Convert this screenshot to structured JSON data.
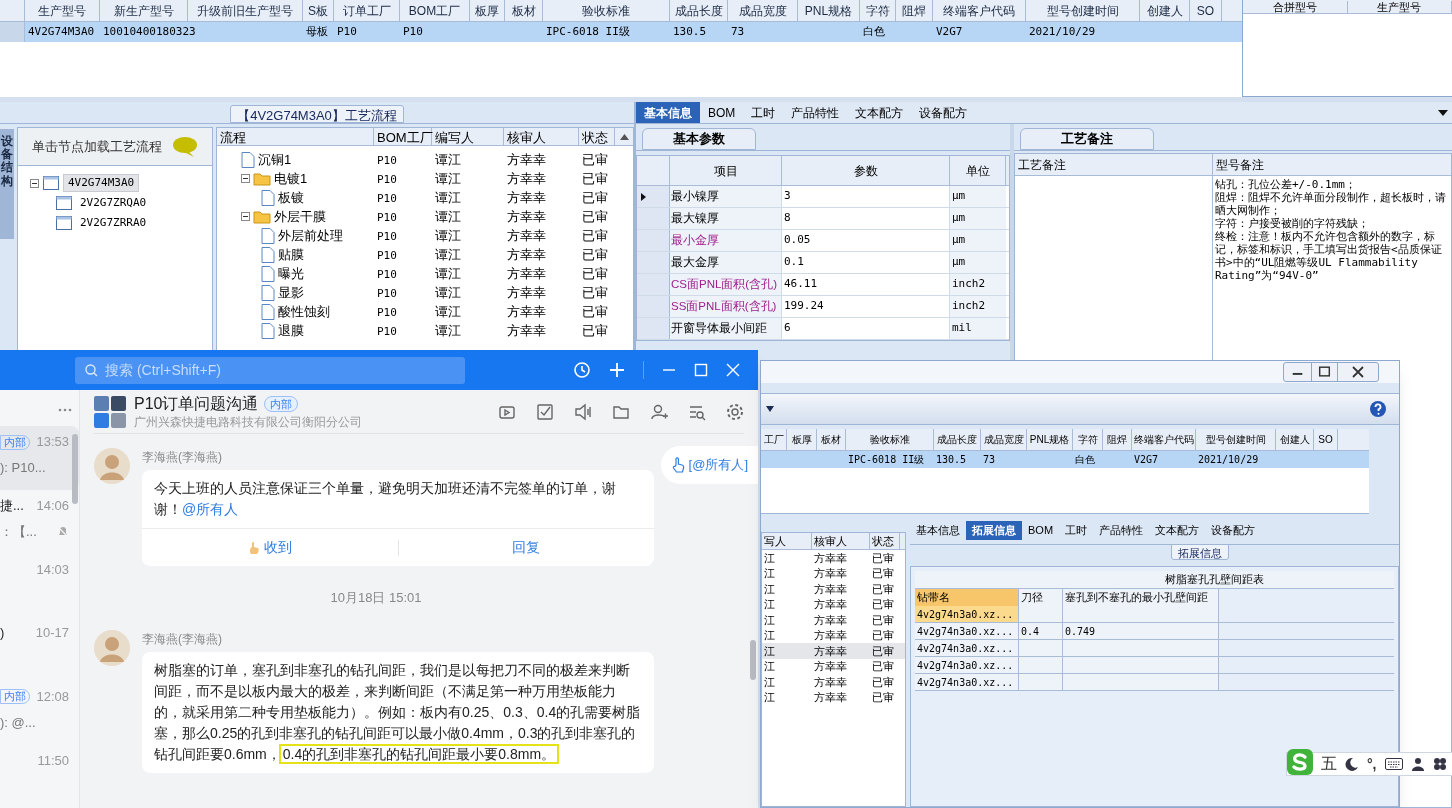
{
  "main_window": {
    "model_table": {
      "row_selected": true,
      "columns": [
        {
          "label": "生产型号",
          "value": "4V2G74M3A0"
        },
        {
          "label": "新生产型号",
          "value": "10010400180323"
        },
        {
          "label": "升级前旧生产型号"
        },
        {
          "label": "S板",
          "value": "母板"
        },
        {
          "label": "订单工厂",
          "value": "P10"
        },
        {
          "label": "BOM工厂",
          "value": "P10"
        },
        {
          "label": "板厚"
        },
        {
          "label": "板材"
        },
        {
          "label": "验收标准",
          "value": "IPC-6018 II级"
        },
        {
          "label": "成品长度",
          "value": "130.5"
        },
        {
          "label": "成品宽度",
          "value": "73"
        },
        {
          "label": "PNL规格"
        },
        {
          "label": "字符",
          "value": "白色"
        },
        {
          "label": "阻焊"
        },
        {
          "label": "终端客户代码",
          "value": "V2G7"
        },
        {
          "label": "型号创建时间",
          "value": "2021/10/29"
        },
        {
          "label": "创建人"
        },
        {
          "label": "SO"
        }
      ]
    },
    "merge_panel": {
      "columns": [
        "合拼型号",
        "生产型号"
      ]
    },
    "process_panel": {
      "title": "【4V2G74M3A0】工艺流程",
      "side_tab": "设备结构",
      "hint": "单击节点加载工艺流程",
      "model_tree": [
        {
          "label": "4V2G74M3A0",
          "selected": true,
          "expanded": true,
          "children": [
            {
              "label": "2V2G7ZRQA0",
              "selected": false
            },
            {
              "label": "2V2G7ZRRA0",
              "selected": false
            }
          ]
        }
      ],
      "flow_columns": [
        "流程",
        "BOM工厂",
        "编写人",
        "核审人",
        "状态"
      ],
      "flow_rows": [
        {
          "kind": "step",
          "name": "沉铜1",
          "bom": "P10",
          "writer": "谭江",
          "reviewer": "方幸幸",
          "status": "已审"
        },
        {
          "kind": "folder",
          "expanded": true,
          "name": "电镀1",
          "bom": "P10",
          "writer": "谭江",
          "reviewer": "方幸幸",
          "status": "已审",
          "children": [
            {
              "kind": "step",
              "name": "板镀",
              "bom": "P10",
              "writer": "谭江",
              "reviewer": "方幸幸",
              "status": "已审"
            }
          ]
        },
        {
          "kind": "folder",
          "expanded": true,
          "name": "外层干膜",
          "bom": "P10",
          "writer": "谭江",
          "reviewer": "方幸幸",
          "status": "已审",
          "children": [
            {
              "kind": "step",
              "name": "外层前处理",
              "bom": "P10",
              "writer": "谭江",
              "reviewer": "方幸幸",
              "status": "已审"
            },
            {
              "kind": "step",
              "name": "贴膜",
              "bom": "P10",
              "writer": "谭江",
              "reviewer": "方幸幸",
              "status": "已审"
            },
            {
              "kind": "step",
              "name": "曝光",
              "bom": "P10",
              "writer": "谭江",
              "reviewer": "方幸幸",
              "status": "已审"
            },
            {
              "kind": "step",
              "name": "显影",
              "bom": "P10",
              "writer": "谭江",
              "reviewer": "方幸幸",
              "status": "已审"
            },
            {
              "kind": "step",
              "name": "酸性蚀刻",
              "bom": "P10",
              "writer": "谭江",
              "reviewer": "方幸幸",
              "status": "已审"
            },
            {
              "kind": "step",
              "name": "退膜",
              "bom": "P10",
              "writer": "谭江",
              "reviewer": "方幸幸",
              "status": "已审"
            }
          ]
        }
      ]
    },
    "info_tabs": [
      {
        "label": "基本信息",
        "selected": true
      },
      {
        "label": "BOM",
        "selected": false
      },
      {
        "label": "工时",
        "selected": false
      },
      {
        "label": "产品特性",
        "selected": false
      },
      {
        "label": "文本配方",
        "selected": false
      },
      {
        "label": "设备配方",
        "selected": false
      }
    ],
    "param_tab": "基本参数",
    "param_columns": [
      "项目",
      "参数",
      "单位"
    ],
    "params": [
      {
        "item": "最小镍厚",
        "value": "3",
        "unit": "μm",
        "highlighted": false,
        "selected": true
      },
      {
        "item": "最大镍厚",
        "value": "8",
        "unit": "μm",
        "highlighted": false,
        "selected": false
      },
      {
        "item": "最小金厚",
        "value": "0.05",
        "unit": "μm",
        "highlighted": true,
        "selected": false
      },
      {
        "item": "最大金厚",
        "value": "0.1",
        "unit": "μm",
        "highlighted": false,
        "selected": false
      },
      {
        "item": "CS面PNL面积(含孔)",
        "value": "46.11",
        "unit": "inch2",
        "highlighted": true,
        "selected": false
      },
      {
        "item": "SS面PNL面积(含孔)",
        "value": "199.24",
        "unit": "inch2",
        "highlighted": true,
        "selected": false
      },
      {
        "item": "开窗导体最小间距",
        "value": "6",
        "unit": "mil",
        "highlighted": false,
        "selected": false
      }
    ],
    "notes_tab": "工艺备注",
    "notes_columns": [
      "工艺备注",
      "型号备注"
    ],
    "model_notes": [
      "钻孔：孔位公差+/-0.1mm；",
      "阻焊：阻焊不允许单面分段制作，超长板时，请晒大网制作；",
      "字符：户接受被削的字符残缺；",
      "终检：注意！板内不允许包含额外的数字，标记，标签和标识，手工填写出货报告<品质保证书>中的“UL阻燃等级UL Flammability Rating”为“94V-0”"
    ]
  },
  "chat_window": {
    "search_placeholder": "搜索 (Ctrl+Shift+F)",
    "conversations": [
      {
        "tag": "内部",
        "time": "13:53",
        "preview": "): P10...",
        "selected": true,
        "muted": false
      },
      {
        "title": "捷...",
        "time": "14:06",
        "preview": "：【...",
        "selected": false,
        "muted": true
      },
      {
        "time": "14:03",
        "selected": false,
        "muted": false
      },
      {
        "title": ")",
        "time": "10-17",
        "selected": false,
        "muted": false
      },
      {
        "tag": "内部",
        "time": "12:08",
        "preview": "): @...",
        "selected": false,
        "muted": false
      },
      {
        "time": "11:50",
        "selected": false,
        "muted": false
      }
    ],
    "group": {
      "name": "P10订单问题沟通",
      "tag": "内部",
      "org": "广州兴森快捷电路科技有限公司衡阳分公司"
    },
    "mention_button": "[@所有人]",
    "messages": [
      {
        "kind": "message",
        "sender": "李海燕(李海燕)",
        "text": "今天上班的人员注意保证三个单量，避免明天加班还清不完签单的订单，谢谢！",
        "mention": "@所有人",
        "actions": [
          "收到",
          "回复"
        ]
      },
      {
        "kind": "divider",
        "text": "10月18日 15:01"
      },
      {
        "kind": "message",
        "sender": "李海燕(李海燕)",
        "text": "树脂塞的订单，塞孔到非塞孔的钻孔间距，我们是以每把刀不同的极差来判断间距，而不是以板内最大的极差，来判断间距（不满足第一种万用垫板能力的，就采用第二种专用垫板能力）。例如：板内有0.25、0.3、0.4的孔需要树脂塞，那么0.25的孔到非塞孔的钻孔间距可以最小做0.4mm，0.3的孔到非塞孔的钻孔间距要0.6mm，",
        "highlight": "0.4的孔到非塞孔的钻孔间距最小要0.8mm。"
      }
    ]
  },
  "detail_window": {
    "columns": [
      {
        "label": "工厂"
      },
      {
        "label": "板厚"
      },
      {
        "label": "板材"
      },
      {
        "label": "验收标准",
        "value": "IPC-6018 II级"
      },
      {
        "label": "成品长度",
        "value": "130.5"
      },
      {
        "label": "成品宽度",
        "value": "73"
      },
      {
        "label": "PNL规格"
      },
      {
        "label": "字符",
        "value": "白色"
      },
      {
        "label": "阻焊"
      },
      {
        "label": "终端客户代码",
        "value": "V2G7"
      },
      {
        "label": "型号创建时间",
        "value": "2021/10/29"
      },
      {
        "label": "创建人"
      },
      {
        "label": "SO"
      }
    ],
    "flow_columns": [
      "写人",
      "核审人",
      "状态"
    ],
    "flow_rows": [
      {
        "writer": "江",
        "reviewer": "方幸幸",
        "status": "已审",
        "selected": false
      },
      {
        "writer": "江",
        "reviewer": "方幸幸",
        "status": "已审",
        "selected": false
      },
      {
        "writer": "江",
        "reviewer": "方幸幸",
        "status": "已审",
        "selected": false
      },
      {
        "writer": "江",
        "reviewer": "方幸幸",
        "status": "已审",
        "selected": false
      },
      {
        "writer": "江",
        "reviewer": "方幸幸",
        "status": "已审",
        "selected": false
      },
      {
        "writer": "江",
        "reviewer": "方幸幸",
        "status": "已审",
        "selected": false
      },
      {
        "writer": "江",
        "reviewer": "方幸幸",
        "status": "已审",
        "selected": true
      },
      {
        "writer": "江",
        "reviewer": "方幸幸",
        "status": "已审",
        "selected": false
      },
      {
        "writer": "江",
        "reviewer": "方幸幸",
        "status": "已审",
        "selected": false
      },
      {
        "writer": "江",
        "reviewer": "方幸幸",
        "status": "已审",
        "selected": false
      }
    ],
    "tabs": [
      {
        "label": "基本信息",
        "selected": false
      },
      {
        "label": "拓展信息",
        "selected": true
      },
      {
        "label": "BOM",
        "selected": false
      },
      {
        "label": "工时",
        "selected": false
      },
      {
        "label": "产品特性",
        "selected": false
      },
      {
        "label": "文本配方",
        "selected": false
      },
      {
        "label": "设备配方",
        "selected": false
      }
    ],
    "section_label": "拓展信息",
    "table_title": "树脂塞孔孔壁间距表",
    "hole_columns": [
      "钻带名",
      "刀径",
      "塞孔到不塞孔的最小孔壁间距"
    ],
    "hole_rows": [
      {
        "name": "4v2g74n3a0.xz...",
        "selected": true
      },
      {
        "name": "4v2g74n3a0.xz...",
        "diameter": "0.4",
        "spacing": "0.749",
        "selected": false
      },
      {
        "name": "4v2g74n3a0.xz...",
        "selected": false
      },
      {
        "name": "4v2g74n3a0.xz...",
        "selected": false
      },
      {
        "name": "4v2g74n3a0.xz...",
        "selected": false
      }
    ]
  },
  "ime_toolbar": {
    "mode": "五",
    "punctuation": "°,"
  }
}
